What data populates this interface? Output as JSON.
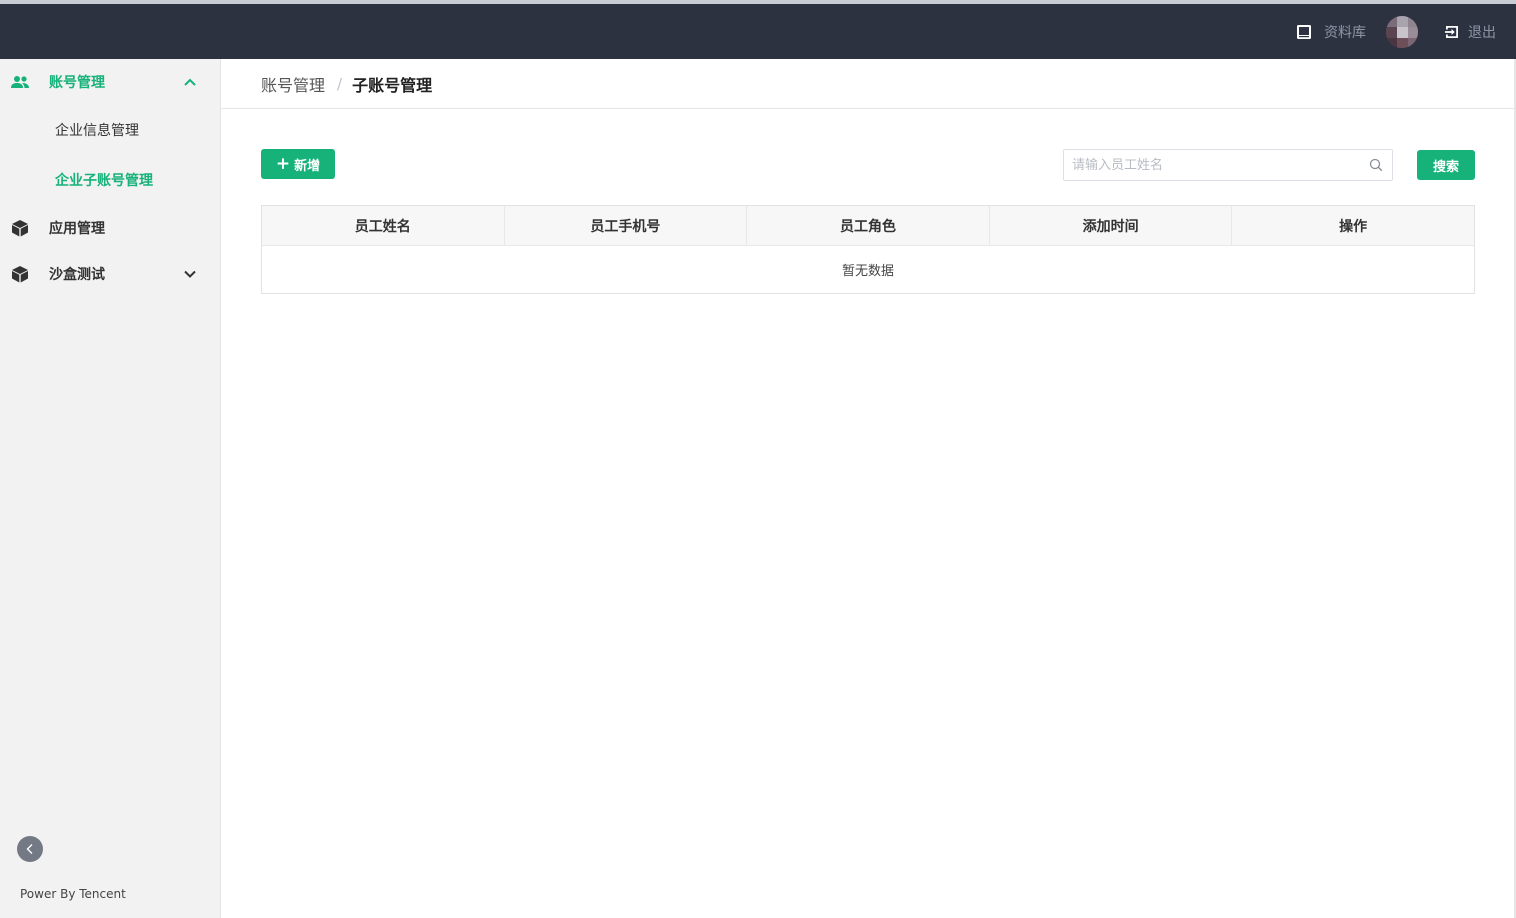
{
  "header": {
    "library_label": "资料库",
    "logout_label": "退出"
  },
  "sidebar": {
    "groups": [
      {
        "label": "账号管理",
        "icon": "users-icon",
        "expanded": true
      },
      {
        "label": "应用管理",
        "icon": "cube-icon",
        "expanded": false
      },
      {
        "label": "沙盒测试",
        "icon": "cube-icon",
        "expanded": false
      }
    ],
    "account_sub_items": [
      {
        "label": "企业信息管理",
        "active": false
      },
      {
        "label": "企业子账号管理",
        "active": true
      }
    ],
    "footer": "Power By Tencent"
  },
  "breadcrumb": {
    "parent": "账号管理",
    "separator": "/",
    "current": "子账号管理"
  },
  "toolbar": {
    "add_label": "新增",
    "search_placeholder": "请输入员工姓名",
    "search_value": "",
    "search_button": "搜索"
  },
  "table": {
    "columns": [
      "员工姓名",
      "员工手机号",
      "员工角色",
      "添加时间",
      "操作"
    ],
    "rows": [],
    "empty_text": "暂无数据"
  },
  "colors": {
    "accent": "#17b27a",
    "header_bg": "#2d3240",
    "sidebar_bg": "#f2f2f2"
  }
}
